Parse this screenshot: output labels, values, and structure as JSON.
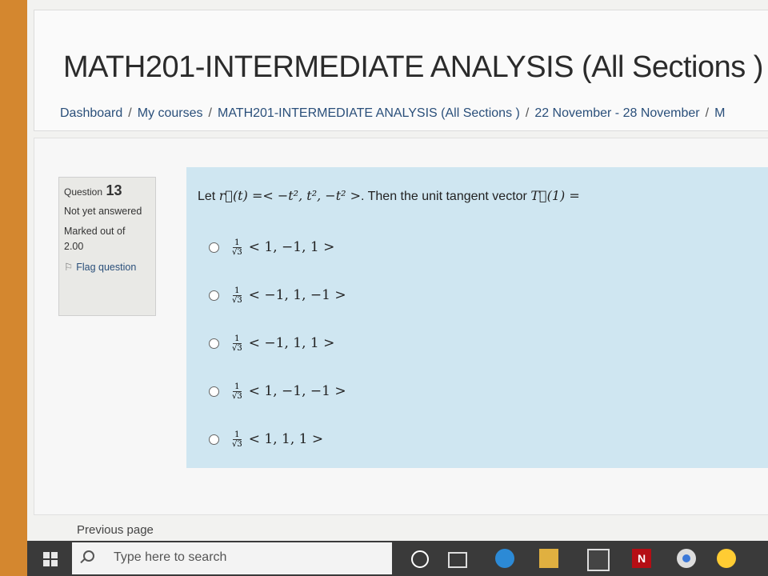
{
  "course": {
    "title": "MATH201-INTERMEDIATE ANALYSIS (All Sections )"
  },
  "breadcrumb": [
    "Dashboard",
    "My courses",
    "MATH201-INTERMEDIATE ANALYSIS (All Sections )",
    "22 November - 28 November",
    "M"
  ],
  "question_info": {
    "label": "Question",
    "number": "13",
    "status": "Not yet answered",
    "marked": "Marked out of",
    "mark": "2.00",
    "flag": "Flag question"
  },
  "question": {
    "text_prefix": "Let ",
    "r_func": "r⃗(t)",
    "vector_expr": " =< −t², t², −t² >",
    "text_middle": ". Then the unit tangent vector ",
    "T_expr": "T⃗(1) ="
  },
  "fraction": {
    "num": "1",
    "den": "√3"
  },
  "options": [
    {
      "vector": "< 1, −1, 1 >"
    },
    {
      "vector": "< −1, 1, −1 >"
    },
    {
      "vector": "< −1, 1, 1 >"
    },
    {
      "vector": "< 1, −1, −1 >"
    },
    {
      "vector": "< 1, 1, 1 >"
    }
  ],
  "nav": {
    "previous": "Previous page"
  },
  "taskbar": {
    "search_placeholder": "Type here to search",
    "netflix_letter": "N"
  }
}
